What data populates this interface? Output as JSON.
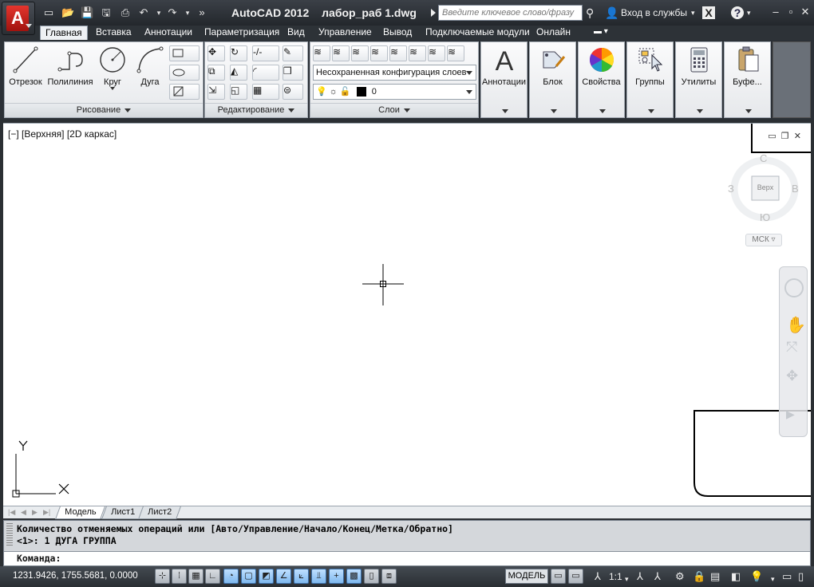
{
  "title": {
    "app_name": "AutoCAD 2012",
    "file_name": "лабор_раб 1.dwg",
    "search_placeholder": "Введите ключевое слово/фразу",
    "login_label": "Вход в службы"
  },
  "tabs": [
    {
      "label": "Главная",
      "active": true
    },
    {
      "label": "Вставка"
    },
    {
      "label": "Аннотации"
    },
    {
      "label": "Параметризация"
    },
    {
      "label": "Вид"
    },
    {
      "label": "Управление"
    },
    {
      "label": "Вывод"
    },
    {
      "label": "Подключаемые модули"
    },
    {
      "label": "Онлайн"
    }
  ],
  "ribbon": {
    "draw": {
      "label": "Рисование",
      "line": "Отрезок",
      "polyline": "Полилиния",
      "circle": "Круг",
      "arc": "Дуга"
    },
    "modify": {
      "label": "Редактирование"
    },
    "layers": {
      "label": "Слои",
      "layer_state": "Несохраненная конфигурация слоев",
      "current_layer": "0"
    },
    "annotation": "Аннотации",
    "block": "Блок",
    "properties": "Свойства",
    "groups": "Группы",
    "utilities": "Утилиты",
    "clipboard": "Буфе..."
  },
  "viewport": {
    "label": "[−] [Верхняя] [2D каркас]",
    "viewcube": {
      "top": "Верх",
      "north": "С",
      "south": "Ю",
      "west": "З",
      "east": "В",
      "ucs": "МСК"
    },
    "ucs_x": "X",
    "ucs_y": "Y"
  },
  "layout_tabs": [
    {
      "label": "Модель",
      "active": true
    },
    {
      "label": "Лист1"
    },
    {
      "label": "Лист2"
    }
  ],
  "command": {
    "line1": "Количество отменяемых операций или [Авто/Управление/Начало/Конец/Метка/Обратно]",
    "line2": "<1>: 1 ДУГА ГРУППА",
    "prompt": "Команда:"
  },
  "status": {
    "coordinates": "1231.9426, 1755.5681, 0.0000",
    "model": "МОДЕЛЬ",
    "scale": "1:1"
  },
  "colors": {
    "accent_red": "#d8251f",
    "ui_dark": "#2b3036"
  }
}
